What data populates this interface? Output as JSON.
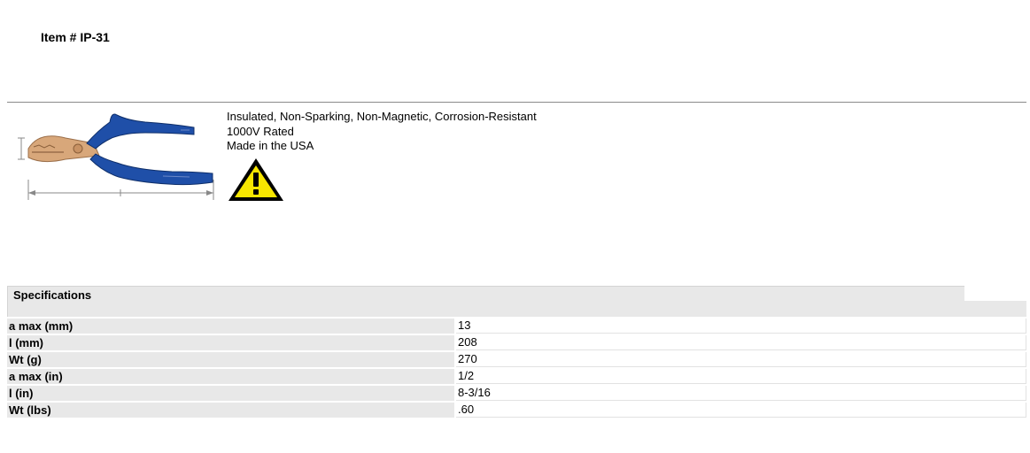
{
  "item": {
    "title": "Item # IP-31"
  },
  "product": {
    "image_icon": "insulated-pliers-image",
    "description_lines": [
      "Insulated, Non-Sparking, Non-Magnetic, Corrosion-Resistant",
      "1000V Rated",
      "Made in the USA"
    ],
    "warning_icon": "warning-triangle-icon",
    "colors": {
      "handle": "#1f4fa8",
      "jaw": "#d8a77a",
      "warning_yellow": "#f7e600"
    }
  },
  "specifications": {
    "title": "Specifications",
    "rows": [
      {
        "label": "a max (mm)",
        "value": "13"
      },
      {
        "label": "l (mm)",
        "value": "208"
      },
      {
        "label": "Wt (g)",
        "value": "270"
      },
      {
        "label": "a max (in)",
        "value": "1/2"
      },
      {
        "label": "l (in)",
        "value": "8-3/16"
      },
      {
        "label": "Wt (lbs)",
        "value": ".60"
      }
    ]
  }
}
